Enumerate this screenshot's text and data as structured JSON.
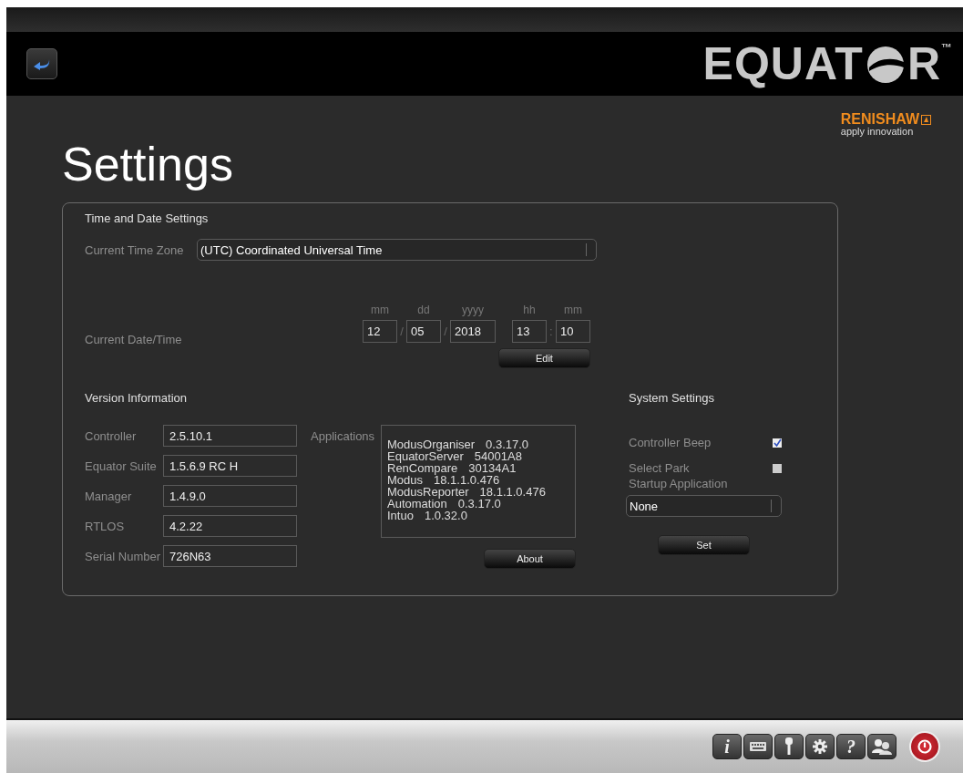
{
  "header": {
    "logo": {
      "before": "EQUAT",
      "after": "R",
      "tm": "™"
    },
    "brand": {
      "name": "RENISHAW",
      "tagline": "apply innovation"
    }
  },
  "title": "Settings",
  "time_date": {
    "heading": "Time and Date Settings",
    "timezone": {
      "label": "Current Time Zone",
      "value": "(UTC) Coordinated Universal Time"
    },
    "datetime": {
      "label": "Current Date/Time",
      "parts": [
        {
          "unit": "mm",
          "value": "12",
          "sep": "/"
        },
        {
          "unit": "dd",
          "value": "05",
          "sep": "/"
        },
        {
          "unit": "yyyy",
          "value": "2018"
        },
        {
          "unit": "hh",
          "value": "13",
          "sep": ":"
        },
        {
          "unit": "mm",
          "value": "10"
        }
      ]
    },
    "button": "Edit"
  },
  "version": {
    "heading": "Version Information",
    "fields": [
      {
        "label": "Controller",
        "value": "2.5.10.1"
      },
      {
        "label": "Equator Suite",
        "value": "1.5.6.9 RC H"
      },
      {
        "label": "Manager",
        "value": "1.4.9.0"
      },
      {
        "label": "RTLOS",
        "value": "4.2.22"
      },
      {
        "label": "Serial Number",
        "value": "726N63"
      }
    ],
    "applications_label": "Applications",
    "applications": [
      {
        "name": "ModusOrganiser",
        "version": "0.3.17.0"
      },
      {
        "name": "EquatorServer",
        "version": "54001A8"
      },
      {
        "name": "RenCompare",
        "version": "30134A1"
      },
      {
        "name": "Modus",
        "version": "18.1.1.0.476"
      },
      {
        "name": "ModusReporter",
        "version": "18.1.1.0.476"
      },
      {
        "name": "Automation",
        "version": "0.3.17.0"
      },
      {
        "name": "Intuo",
        "version": "1.0.32.0"
      }
    ],
    "button": "About"
  },
  "system": {
    "heading": "System Settings",
    "options": [
      {
        "label": "Controller Beep",
        "checked": true
      },
      {
        "label": "Select Park",
        "checked": false
      }
    ],
    "startup": {
      "label": "Startup Application",
      "value": "None"
    },
    "button": "Set"
  },
  "toolbar": [
    {
      "kind": "glyph",
      "label": "i"
    },
    {
      "kind": "keyboard"
    },
    {
      "kind": "key"
    },
    {
      "kind": "gear"
    },
    {
      "kind": "glyph",
      "label": "?"
    },
    {
      "kind": "users"
    },
    {
      "kind": "power"
    }
  ]
}
